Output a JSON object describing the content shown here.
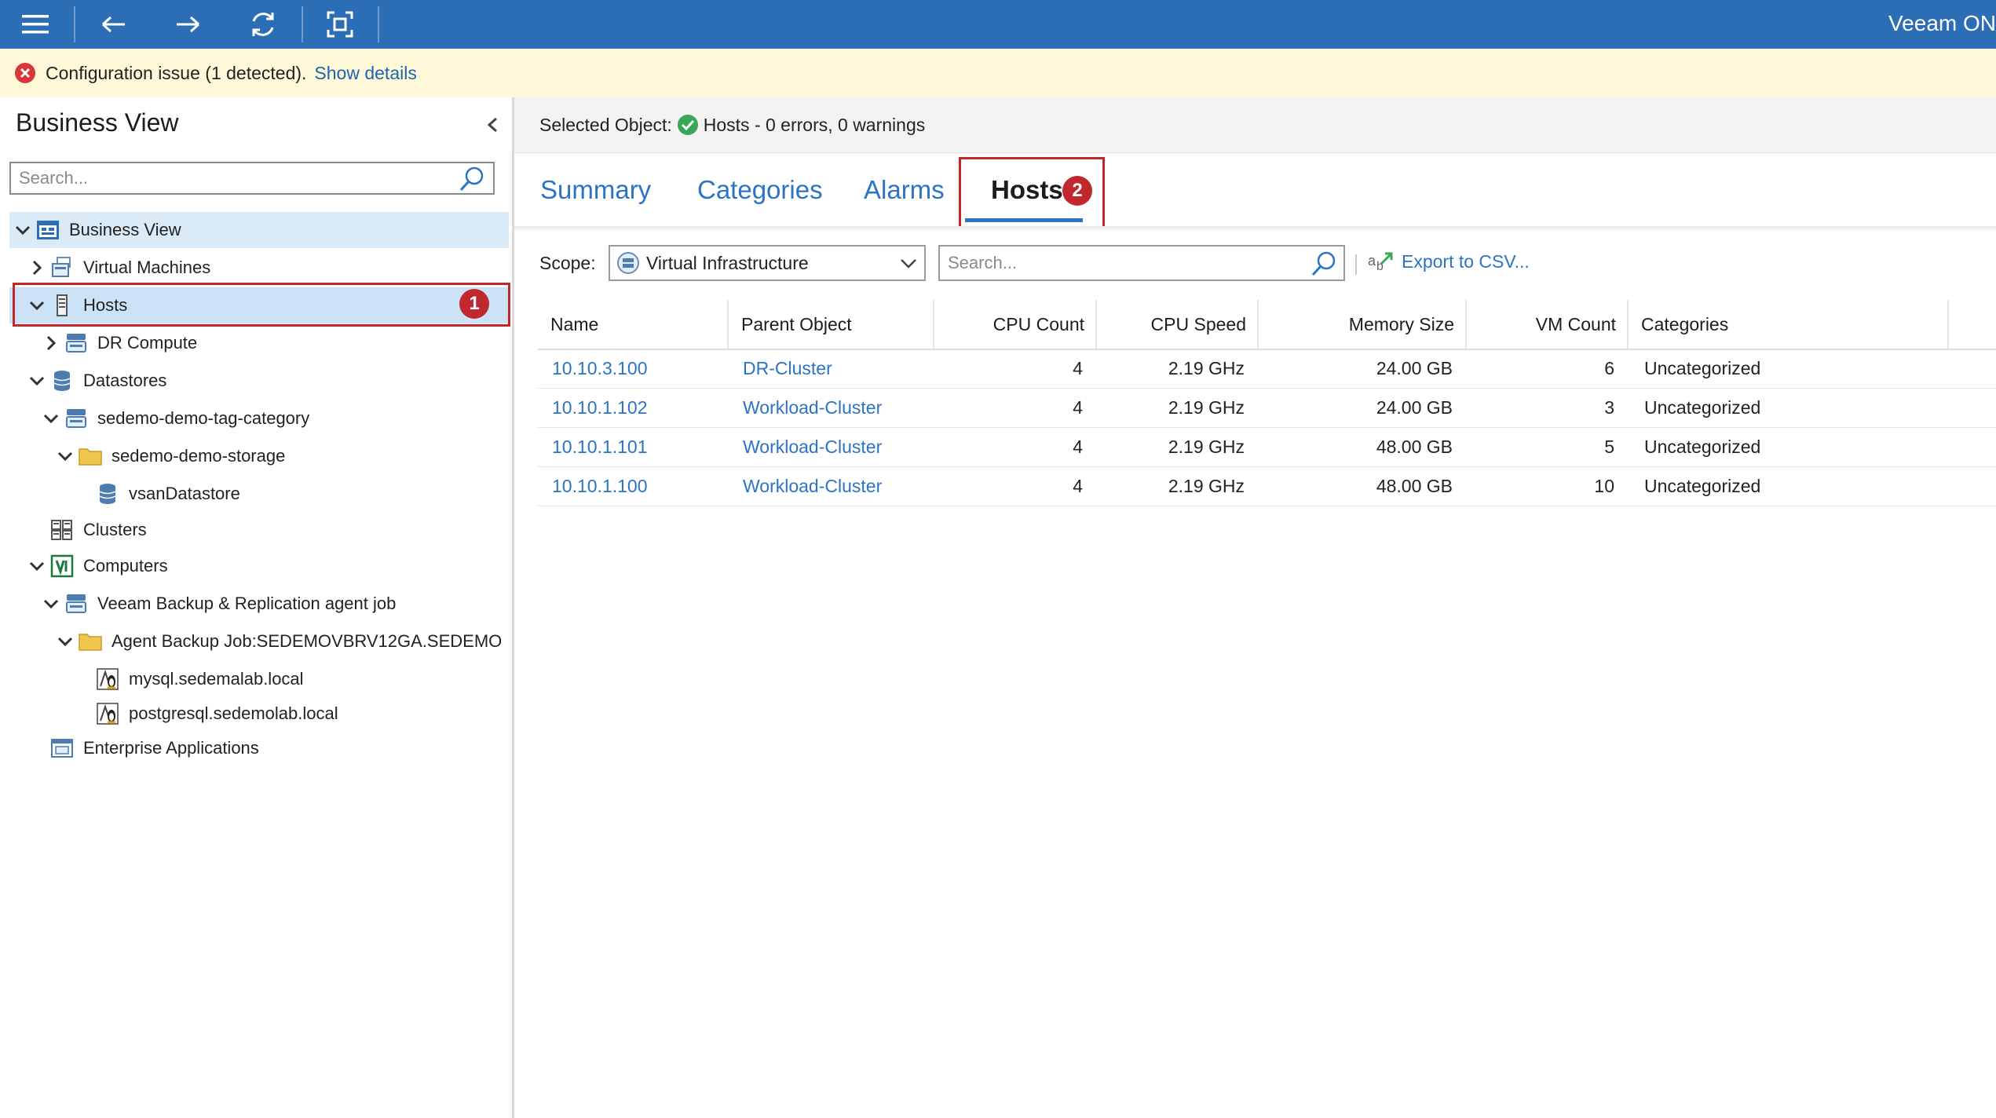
{
  "app": {
    "title": "Veeam ON"
  },
  "banner": {
    "message": "Configuration issue (1 detected).",
    "link": "Show details"
  },
  "left_panel": {
    "title": "Business View",
    "search_placeholder": "Search...",
    "tree": [
      {
        "label": "Business View",
        "icon": "business-view-icon",
        "level": 0,
        "expanded": true
      },
      {
        "label": "Virtual Machines",
        "icon": "virtual-machines-icon",
        "level": 1,
        "expanded": false
      },
      {
        "label": "Hosts",
        "icon": "host-icon",
        "level": 1,
        "expanded": true,
        "selected": true
      },
      {
        "label": "DR Compute",
        "icon": "category-icon",
        "level": 2,
        "expanded": false
      },
      {
        "label": "Datastores",
        "icon": "datastore-icon",
        "level": 1,
        "expanded": true
      },
      {
        "label": "sedemo-demo-tag-category",
        "icon": "category-icon",
        "level": 2,
        "expanded": true
      },
      {
        "label": "sedemo-demo-storage",
        "icon": "folder-icon",
        "level": 3,
        "expanded": true
      },
      {
        "label": "vsanDatastore",
        "icon": "datastore-icon",
        "level": 4
      },
      {
        "label": "Clusters",
        "icon": "cluster-icon",
        "level": 1
      },
      {
        "label": "Computers",
        "icon": "computers-icon",
        "level": 1,
        "expanded": true
      },
      {
        "label": "Veeam Backup & Replication agent job",
        "icon": "category-icon",
        "level": 2,
        "expanded": true
      },
      {
        "label": "Agent Backup Job:SEDEMOVBRV12GA.SEDEMO",
        "icon": "folder-icon",
        "level": 3,
        "expanded": true
      },
      {
        "label": "mysql.sedemalab.local",
        "icon": "linux-icon",
        "level": 4
      },
      {
        "label": "postgresql.sedemolab.local",
        "icon": "linux-icon",
        "level": 4
      },
      {
        "label": "Enterprise Applications",
        "icon": "enterprise-apps-icon",
        "level": 1
      }
    ]
  },
  "annotations": {
    "badge1": "1",
    "badge2": "2"
  },
  "selected_object": {
    "label": "Selected Object:",
    "status": "Hosts - 0 errors, 0 warnings"
  },
  "tabs": [
    {
      "label": "Summary",
      "active": false
    },
    {
      "label": "Categories",
      "active": false
    },
    {
      "label": "Alarms",
      "active": false
    },
    {
      "label": "Hosts",
      "active": true
    }
  ],
  "toolbar": {
    "scope_label": "Scope:",
    "scope_value": "Virtual Infrastructure",
    "search_placeholder": "Search...",
    "export_label": "Export to CSV..."
  },
  "table": {
    "columns": [
      "Name",
      "Parent Object",
      "CPU Count",
      "CPU Speed",
      "Memory Size",
      "VM Count",
      "Categories"
    ],
    "rows": [
      [
        "10.10.3.100",
        "DR-Cluster",
        "4",
        "2.19 GHz",
        "24.00 GB",
        "6",
        "Uncategorized"
      ],
      [
        "10.10.1.102",
        "Workload-Cluster",
        "4",
        "2.19 GHz",
        "24.00 GB",
        "3",
        "Uncategorized"
      ],
      [
        "10.10.1.101",
        "Workload-Cluster",
        "4",
        "2.19 GHz",
        "48.00 GB",
        "5",
        "Uncategorized"
      ],
      [
        "10.10.1.100",
        "Workload-Cluster",
        "4",
        "2.19 GHz",
        "48.00 GB",
        "10",
        "Uncategorized"
      ]
    ]
  },
  "colors": {
    "topbar": "#2c6eb5",
    "link": "#2b74c4",
    "annotation": "#c0282d",
    "selected_row": "#cce2f6"
  }
}
